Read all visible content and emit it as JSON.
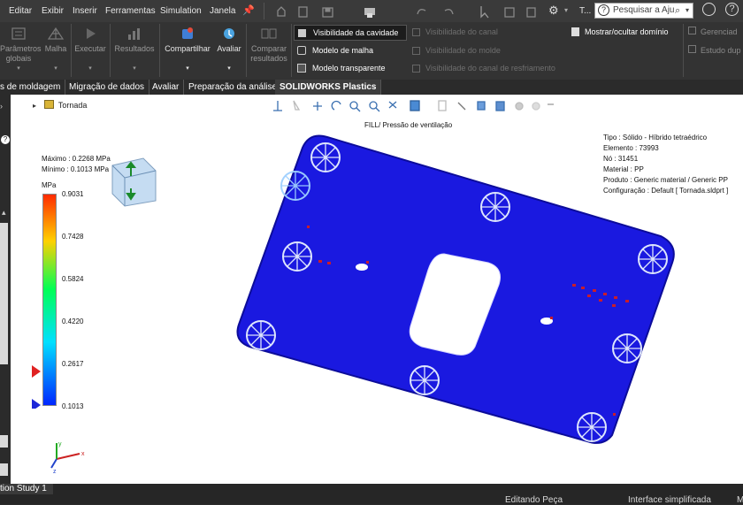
{
  "menu": {
    "items": [
      "Editar",
      "Exibir",
      "Inserir",
      "Ferramentas",
      "Simulation",
      "Janela"
    ],
    "search_placeholder": "Pesquisar a Aju",
    "user_initial": "T..."
  },
  "ribbon": {
    "groups": [
      {
        "label": "Parâmetros globais",
        "line1": "Parâmetros",
        "line2": "globais"
      },
      {
        "label": "Malha",
        "line1": "Malha",
        "line2": ""
      },
      {
        "label": "Executar",
        "line1": "Executar",
        "line2": ""
      },
      {
        "label": "Resultados",
        "line1": "Resultados",
        "line2": ""
      },
      {
        "label": "Compartilhar",
        "line1": "Compartilhar",
        "line2": ""
      },
      {
        "label": "Avaliar",
        "line1": "Avaliar",
        "line2": ""
      },
      {
        "label": "Comparar resultados",
        "line1": "Comparar",
        "line2": "resultados"
      }
    ],
    "visibility": [
      {
        "label": "Visibilidade da cavidade",
        "active": true
      },
      {
        "label": "Modelo de malha",
        "active": true
      },
      {
        "label": "Modelo transparente",
        "active": true
      },
      {
        "label": "Visibilidade do canal",
        "active": false
      },
      {
        "label": "Visibilidade do molde",
        "active": false
      },
      {
        "label": "Visibilidade do canal de resfriamento",
        "active": false
      }
    ],
    "domain_toggle": "Mostrar/ocultar domínio",
    "right_items": [
      "Gerenciad",
      "Estudo dup"
    ]
  },
  "tabs": [
    {
      "label": "s de moldagem",
      "active": false
    },
    {
      "label": "Migração de dados",
      "active": false
    },
    {
      "label": "Avaliar",
      "active": false
    },
    {
      "label": "Preparação da análise",
      "active": false
    },
    {
      "label": "SOLIDWORKS Plastics",
      "active": true
    }
  ],
  "tree": {
    "root": "Tornada"
  },
  "plot": {
    "title": "FILL/ Pressão de ventilação",
    "max_label": "Máximo : 0.2268 MPa",
    "min_label": "Mínimo : 0.1013 MPa",
    "unit": "MPa",
    "scale_values": [
      "0.9031",
      "0.7428",
      "0.5824",
      "0.4220",
      "0.2617",
      "0.1013"
    ],
    "colors": {
      "top": "#ff2a00",
      "mid": "#00ff55",
      "bottom": "#0026ff",
      "part": "#1a19e0"
    }
  },
  "info": {
    "lines": [
      "Tipo : Sólido - Híbrido tetraédrico",
      "Elemento : 73993",
      "Nó : 31451",
      "Material : PP",
      "Produto : Generic material / Generic PP",
      "Configuração : Default [ Tornada.sldprt ]"
    ]
  },
  "triad": {
    "x": "x",
    "y": "y",
    "z": "z"
  },
  "status": {
    "study": "tion Study 1",
    "editing": "Editando Peça",
    "interface": "Interface simplificada",
    "tail": "M"
  }
}
